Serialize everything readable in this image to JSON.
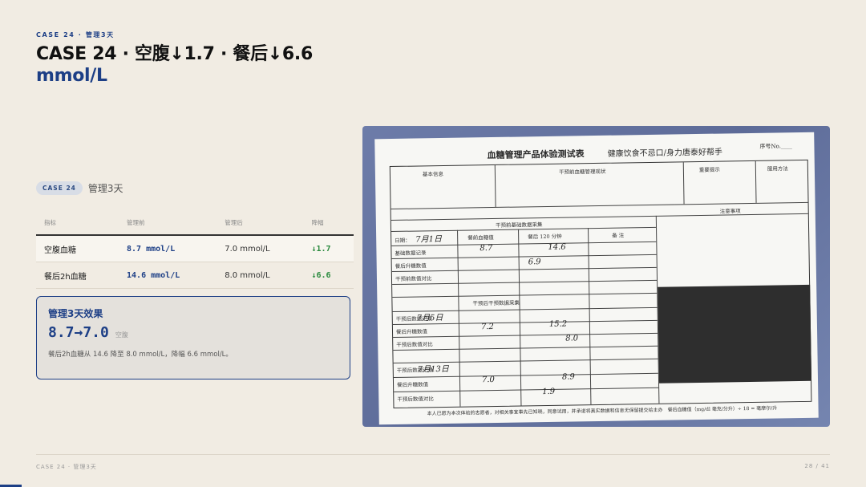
{
  "header": {
    "eyebrow": "CASE 24 · 管理3天",
    "title": "CASE 24 · 空腹↓1.7 · 餐后↓6.6",
    "title_accent": "mmol/L"
  },
  "tag": {
    "pill": "CASE 24",
    "text": "管理3天"
  },
  "table": {
    "headers": [
      "指标",
      "管理前",
      "管理后",
      "降幅"
    ],
    "rows": [
      {
        "metric": "空腹血糖",
        "before": "8.7 mmol/L",
        "after": "7.0 mmol/L",
        "drop": "↓1.7"
      },
      {
        "metric": "餐后2h血糖",
        "before": "14.6 mmol/L",
        "after": "8.0 mmol/L",
        "drop": "↓6.6"
      }
    ]
  },
  "card": {
    "title": "管理3天效果",
    "value": "8.7→7.0",
    "value_label": "空腹",
    "desc": "餐后2h血糖从 14.6 降至 8.0 mmol/L，降幅 6.6 mmol/L。"
  },
  "photo": {
    "form_title": "血糖管理产品体验测试表",
    "slogan": "健康饮食不忌口/身力唐泰好帮手",
    "serial": "序号No.____",
    "sections": [
      "基本信息",
      "干预前血糖管理现状",
      "重要提示",
      "服用方法"
    ],
    "section_dry": "干预前基础数据采集",
    "section_after": "干预后干预数据采集",
    "notes_title": "注意事项",
    "row_labels": [
      "日期：",
      "基础数据记录",
      "餐后升糖数值",
      "干预前数值对比",
      "干预后数据记录",
      "餐后升糖数值",
      "干预后数值对比",
      "干预后数据记录",
      "餐后升糖数值",
      "干预后数值对比"
    ],
    "col_labels": [
      "餐前血糖值",
      "餐后 120 分钟",
      "备 注"
    ],
    "handwritten": {
      "date1": "7月1日",
      "fast1": "8.7",
      "post1": "14.6",
      "note1": "6.9",
      "date2": "7月5日",
      "fast2": "7.2",
      "post2": "15.2",
      "note2": "8.0",
      "date3": "7月13日",
      "fast3": "7.0",
      "post3": "8.9",
      "note3": "1.9"
    },
    "footer": "本人已愿为本次体验的志愿者，对相关事宜事先已知晓，同意试用，并承诺将真实数据和信息无保留提交给主办",
    "footer_right": "餐后血糖值（mg/dl 毫克/分升）÷ 18 = 毫摩尔/升"
  },
  "footer": {
    "left": "CASE 24 · 管理3天",
    "right": "28 / 41"
  }
}
